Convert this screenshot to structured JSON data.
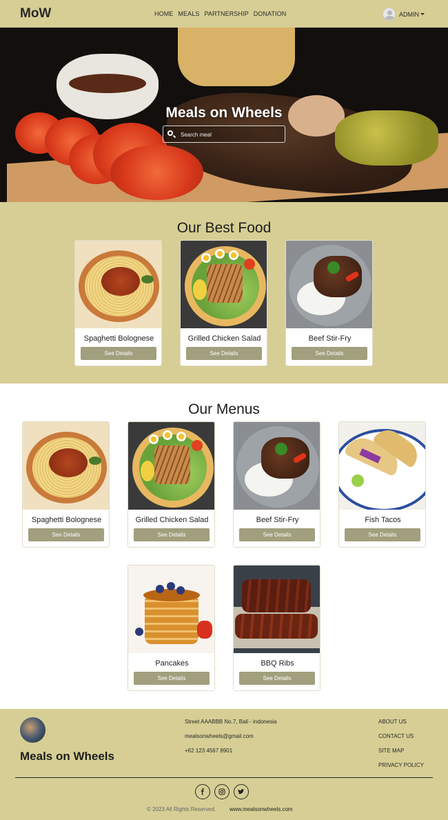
{
  "nav": {
    "brand": "MoW",
    "links": [
      "HOME",
      "MEALS",
      "PARTNERSHIP",
      "DONATION"
    ],
    "user": "ADMIN"
  },
  "hero": {
    "title": "Meals on Wheels",
    "search_placeholder": "Search meal"
  },
  "best": {
    "title": "Our Best Food",
    "items": [
      {
        "name": "Spaghetti Bolognese",
        "button": "See Details"
      },
      {
        "name": "Grilled Chicken Salad",
        "button": "See Details"
      },
      {
        "name": "Beef Stir-Fry",
        "button": "See Details"
      }
    ]
  },
  "menus": {
    "title": "Our Menus",
    "items": [
      {
        "name": "Spaghetti Bolognese",
        "button": "See Details"
      },
      {
        "name": "Grilled Chicken Salad",
        "button": "See Details"
      },
      {
        "name": "Beef Stir-Fry",
        "button": "See Details"
      },
      {
        "name": "Fish Tacos",
        "button": "See Details"
      },
      {
        "name": "Pancakes",
        "button": "See Details"
      },
      {
        "name": "BBQ Ribs",
        "button": "See Details"
      }
    ]
  },
  "footer": {
    "brand": "Meals on Wheels",
    "address": "Street AAABBB No.7, Bali - indonesia",
    "email": "mealsonwheels@gmail.com",
    "phone": "+62 123 4567 8901",
    "links": [
      "ABOUT US",
      "CONTACT US",
      "SITE MAP",
      "PRIVACY POLICY"
    ],
    "social": [
      "facebook-icon",
      "instagram-icon",
      "twitter-icon"
    ],
    "copyright": "© 2023 All Rights Reserved.",
    "site": "www.mealsonwheels.com"
  },
  "colors": {
    "accent": "#d6ce94",
    "button": "#a19f7d"
  }
}
